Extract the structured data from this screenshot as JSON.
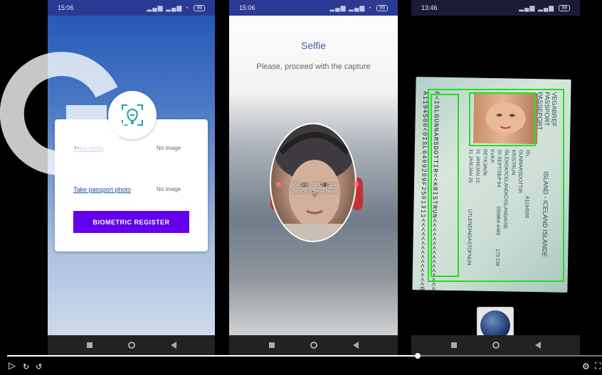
{
  "panel1": {
    "status": {
      "time": "15:06",
      "battery": "99"
    },
    "take_selfie": "Take selfie",
    "take_selfie_status": "No image",
    "take_passport": "Take passport photo",
    "take_passport_status": "No image",
    "cta": "BIOMETRIC REGISTER"
  },
  "panel2": {
    "status": {
      "time": "15:06",
      "battery": "99"
    },
    "title": "Selfie",
    "subtitle": "Please, proceed with the capture",
    "hint": "Please, hold your device to eye level"
  },
  "panel3": {
    "status": {
      "time": "13:46",
      "battery": "99"
    },
    "passport_header": [
      "VEGABREF",
      "PASSPORT",
      "PASSEPORT"
    ],
    "country": "ISLAND - ICELAND ISLANDE",
    "code": "ISL",
    "number": "A1194500",
    "surname": "GUNNARSDOTTIR",
    "given": "KRISTRUN",
    "nationality": "ÍSLENSK/ICELANDIC/ISLANDAISE",
    "dob": "20 SEPT/SEP 64",
    "sex": "KVK/F",
    "pob": "REYKJAVÍK",
    "issue": "31 JAN/JAN 15",
    "expiry": "31 JAN/JAN 25",
    "personal_no": "200964-4469",
    "height": "173 CM",
    "authority": "ÚTLENDINGASTOFNUN",
    "mrz1": "P<ISLGUNNARSDOTTIR<<KRISTRUN<<<<<<<<<<<<<<<<<",
    "mrz2": "A1194500<0ISL6409209F2501311<<<<<<<<<<<<<<<0"
  },
  "player": {
    "progress": 0.69
  },
  "icons": [
    "play-icon",
    "next-icon",
    "settings-icon",
    "fullscreen-icon"
  ],
  "colors": {
    "accent": "#6200ee",
    "detect": "#22e022",
    "status_bar": "#2a3a94"
  }
}
